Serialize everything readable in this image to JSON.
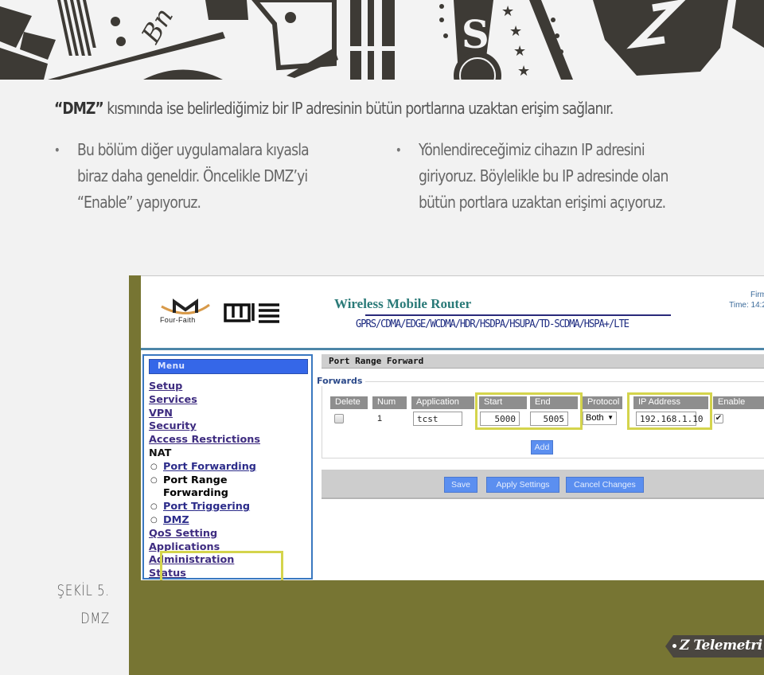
{
  "slide": {
    "lead_bold": "“DMZ”",
    "lead_text": " kısmında ise belirlediğimiz bir IP adresinin bütün portlarına uzaktan erişim sağlanır.",
    "bullets": [
      {
        "lines": [
          "Bu bölüm diğer uygulamalara kıyasla",
          "biraz daha geneldir. Öncelikle DMZ’yi",
          "“Enable” yapıyoruz."
        ]
      },
      {
        "lines": [
          "Yönlendireceğimiz cihazın IP adresini",
          "giriyoruz. Böylelikle bu IP adresinde olan",
          "bütün portlara uzaktan erişimi açıyoruz."
        ]
      }
    ],
    "bullet_glyph": "•",
    "caption": {
      "line1": "ŞEKİL 5.",
      "line2": "DMZ"
    },
    "brand_tag": "Z Telemetri",
    "colors": {
      "frame": "#777533",
      "highlight": "#d4d44c",
      "tag": "#4a4640"
    }
  },
  "router": {
    "brand": "Four-Faith",
    "brand_cn": "四信",
    "title": "Wireless Mobile Router",
    "subtitle": "GPRS/CDMA/EDGE/WCDMA/HDR/HSDPA/HSUPA/TD-SCDMA/HSPA+/LTE",
    "firmware_label": "Firm",
    "time_label": "Time: 14:2",
    "menu": {
      "title": "Menu",
      "items": [
        {
          "label": "Setup"
        },
        {
          "label": "Services"
        },
        {
          "label": "VPN"
        },
        {
          "label": "Security"
        },
        {
          "label": "Access Restrictions"
        }
      ],
      "nat_label": "NAT",
      "nat_sub": [
        {
          "label": "Port Forwarding"
        },
        {
          "label": "Port Range Forwarding",
          "line1": "Port Range",
          "line2": "Forwarding",
          "active": true
        },
        {
          "label": "Port Triggering"
        },
        {
          "label": "DMZ"
        }
      ],
      "items_after": [
        {
          "label": "QoS Setting"
        },
        {
          "label": "Applications"
        },
        {
          "label": "Administration"
        },
        {
          "label": "Status"
        }
      ]
    },
    "section_title": "Port Range Forward",
    "forwards_legend": "Forwards",
    "table": {
      "headers": [
        "Delete",
        "Num",
        "Application",
        "Start",
        "End",
        "Protocol",
        "IP Address",
        "Enable"
      ],
      "rows": [
        {
          "delete": false,
          "num": "1",
          "application": "tcst",
          "start": "5000",
          "end": "5005",
          "protocol": "Both",
          "ip": "192.168.1.10",
          "enable": true
        }
      ]
    },
    "add_button": "Add",
    "buttons": {
      "save": "Save",
      "apply": "Apply Settings",
      "cancel": "Cancel Changes"
    },
    "protocol_arrow": "▼",
    "check_glyph": "✔"
  }
}
